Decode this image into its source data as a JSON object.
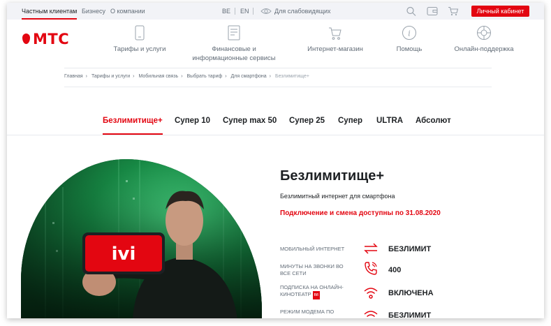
{
  "topbar": {
    "segments": [
      "Частным клиентам",
      "Бизнесу",
      "О компании"
    ],
    "lang": [
      "BE",
      "EN"
    ],
    "accessibility": "Для слабовидящих",
    "cabinet_label": "Личный кабинет"
  },
  "header": {
    "logo_text": "МТС",
    "nav": [
      {
        "label": "Тарифы и услуги",
        "icon": "phone-icon"
      },
      {
        "label": "Финансовые и информационные сервисы",
        "icon": "document-icon"
      },
      {
        "label": "Интернет-магазин",
        "icon": "cart-icon"
      },
      {
        "label": "Помощь",
        "icon": "info-icon"
      },
      {
        "label": "Онлайн-поддержка",
        "icon": "lifebuoy-icon"
      }
    ]
  },
  "breadcrumbs": [
    "Главная",
    "Тарифы и услуги",
    "Мобильная связь",
    "Выбрать тариф",
    "Для смартфона",
    "Безлимитище+"
  ],
  "tabs": [
    "Безлимитище+",
    "Супер 10",
    "Супер max 50",
    "Супер 25",
    "Супер",
    "ULTRA",
    "Абсолют"
  ],
  "tariff": {
    "title": "Безлимитище+",
    "subtitle": "Безлимитный интернет для смартфона",
    "promo": "Подключение и смена доступны по 31.08.2020",
    "features": [
      {
        "label": "Мобильный интернет",
        "value": "БЕЗЛИМИТ",
        "icon": "arrows-icon"
      },
      {
        "label": "Минуты на звонки во все сети",
        "value": "400",
        "icon": "phone-call-icon"
      },
      {
        "label": "Подписка на онлайн-кинотеатр",
        "badge": "ivi",
        "value": "ВКЛЮЧЕНА",
        "icon": "wifi-icon"
      },
      {
        "label": "Режим модема по",
        "value": "БЕЗЛИМИТ",
        "icon": "wifi-icon"
      }
    ]
  },
  "hero": {
    "screen_text": "ivi",
    "accent_color": "#e30611"
  }
}
